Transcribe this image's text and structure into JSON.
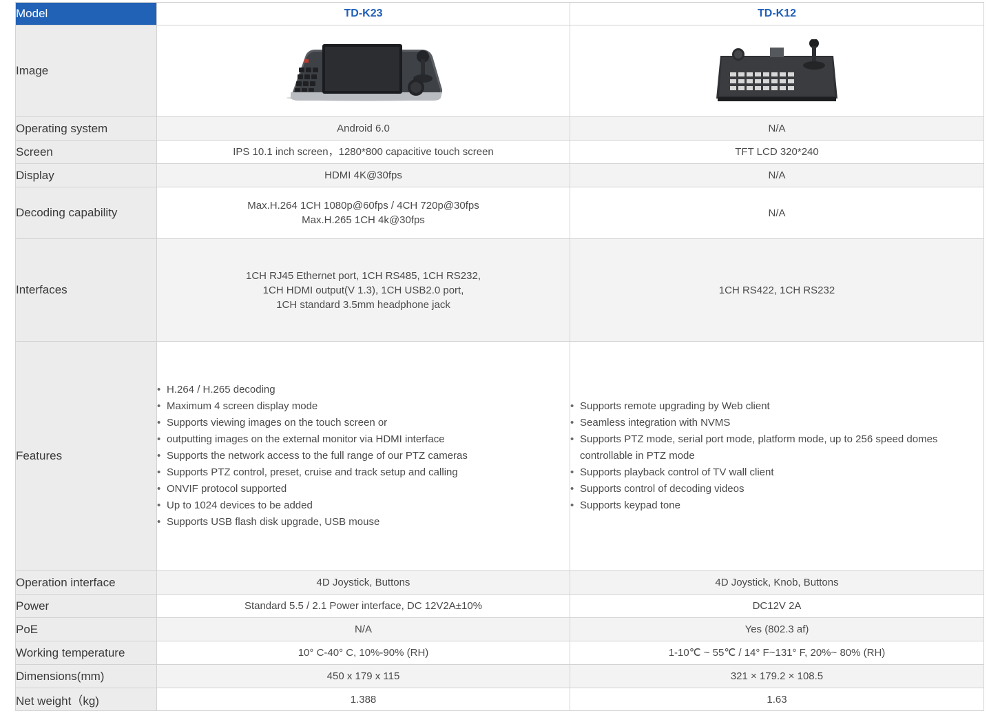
{
  "header": {
    "model_label": "Model",
    "models": [
      "TD-K23",
      "TD-K12"
    ]
  },
  "rows": {
    "image": {
      "label": "Image"
    },
    "os": {
      "label": "Operating system",
      "values": [
        "Android 6.0",
        "N/A"
      ]
    },
    "screen": {
      "label": "Screen",
      "values": [
        "IPS 10.1 inch screen，1280*800 capacitive touch screen",
        "TFT LCD 320*240"
      ]
    },
    "display": {
      "label": "Display",
      "values": [
        "HDMI 4K@30fps",
        "N/A"
      ]
    },
    "decoding": {
      "label": "Decoding capability",
      "k23_lines": [
        "Max.H.264 1CH 1080p@60fps / 4CH 720p@30fps",
        "Max.H.265 1CH 4k@30fps"
      ],
      "k12": "N/A"
    },
    "interfaces": {
      "label": "Interfaces",
      "k23_lines": [
        "1CH RJ45 Ethernet port, 1CH RS485, 1CH RS232,",
        "1CH  HDMI output(V 1.3), 1CH USB2.0 port,",
        "1CH standard 3.5mm headphone jack"
      ],
      "k12": "1CH RS422,  1CH RS232"
    },
    "features": {
      "label": "Features",
      "k23": [
        "H.264 / H.265 decoding",
        "Maximum 4 screen display mode",
        "Supports viewing images on the touch screen or",
        "outputting images on the external monitor via HDMI interface",
        "Supports the network access to the full range of our PTZ cameras",
        "Supports PTZ control, preset, cruise and track setup and calling",
        "ONVIF protocol supported",
        "Up to 1024 devices to be added",
        "Supports USB flash disk upgrade, USB mouse"
      ],
      "k12": [
        "Supports remote upgrading by Web client",
        "Seamless integration with NVMS",
        "Supports PTZ mode, serial port mode, platform mode, up to 256 speed domes controllable in PTZ mode",
        "Supports playback control of TV wall client",
        "Supports control of decoding videos",
        "Supports keypad tone"
      ]
    },
    "operation": {
      "label": "Operation interface",
      "values": [
        "4D Joystick, Buttons",
        "4D Joystick, Knob, Buttons"
      ]
    },
    "power": {
      "label": "Power",
      "values": [
        "Standard 5.5 / 2.1 Power interface, DC 12V2A±10%",
        "DC12V 2A"
      ]
    },
    "poe": {
      "label": "PoE",
      "values": [
        "N/A",
        "Yes (802.3 af)"
      ]
    },
    "temperature": {
      "label": "Working temperature",
      "values": [
        "10° C-40° C, 10%-90% (RH)",
        "1-10℃ ~ 55℃ / 14° F~131° F, 20%~ 80% (RH)"
      ]
    },
    "dimensions": {
      "label": "Dimensions(mm)",
      "values": [
        "450 x 179 x 115",
        "321 × 179.2 × 108.5"
      ]
    },
    "weight": {
      "label": "Net weight（kg)",
      "values": [
        "1.388",
        "1.63"
      ]
    }
  },
  "colors": {
    "header_blue": "#2161b6",
    "label_bg": "#ececec",
    "row_shade": "#f3f3f3",
    "border": "#d3d3d3"
  },
  "icons": {
    "k23_image": "keyboard-controller-touchscreen",
    "k12_image": "keyboard-controller-joystick"
  }
}
